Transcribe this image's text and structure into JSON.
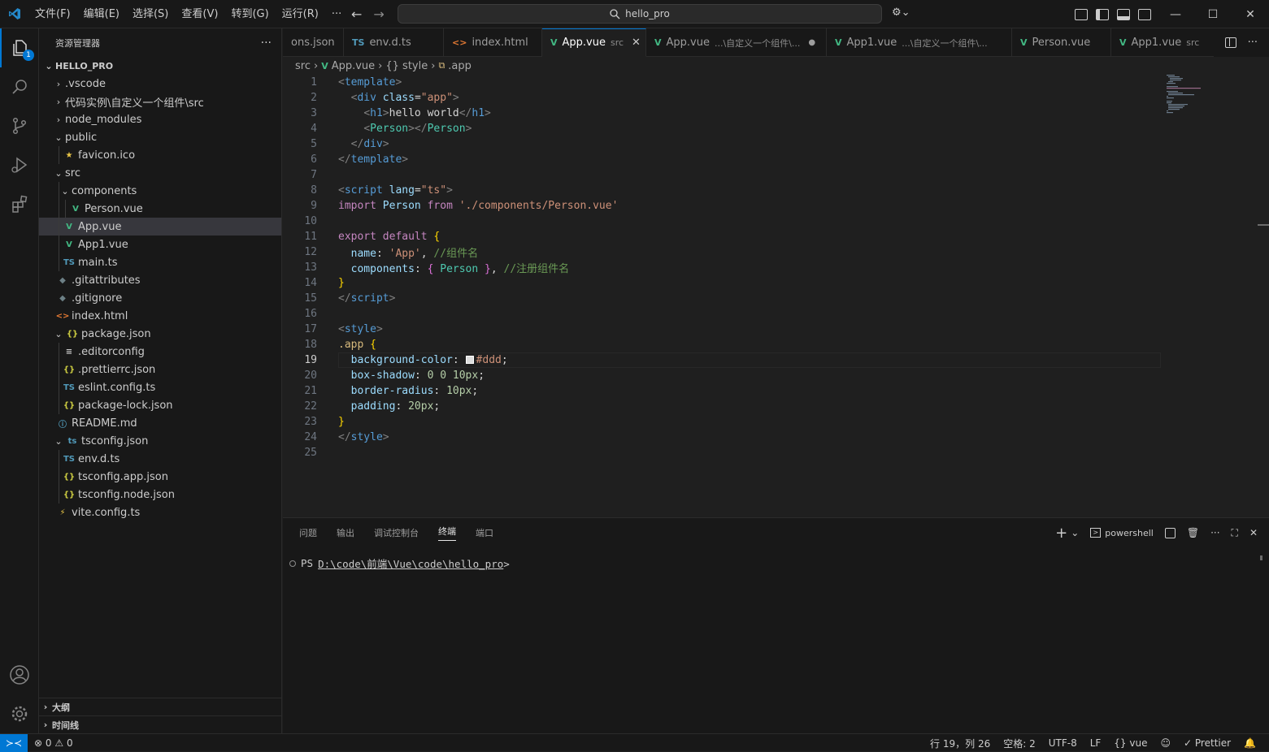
{
  "menu": [
    "文件(F)",
    "编辑(E)",
    "选择(S)",
    "查看(V)",
    "转到(G)",
    "运行(R)",
    "···"
  ],
  "search": {
    "text": "hello_pro"
  },
  "sidebar": {
    "title": "资源管理器",
    "root": "HELLO_PRO",
    "items": [
      {
        "label": ".vscode",
        "depth": 0,
        "kind": "folder",
        "open": false,
        "icon": "",
        "color": "#cccccc"
      },
      {
        "label": "代码实例\\自定义一个组件\\src",
        "depth": 0,
        "kind": "folder",
        "open": false,
        "icon": "",
        "color": "#cccccc"
      },
      {
        "label": "node_modules",
        "depth": 0,
        "kind": "folder",
        "open": false,
        "icon": "",
        "color": "#cccccc"
      },
      {
        "label": "public",
        "depth": 0,
        "kind": "folder",
        "open": true,
        "icon": "",
        "color": "#cccccc"
      },
      {
        "label": "favicon.ico",
        "depth": 1,
        "kind": "file",
        "icon": "★",
        "color": "#e8c547"
      },
      {
        "label": "src",
        "depth": 0,
        "kind": "folder",
        "open": true,
        "icon": "",
        "color": "#cccccc"
      },
      {
        "label": "components",
        "depth": 1,
        "kind": "folder",
        "open": true,
        "icon": "",
        "color": "#cccccc"
      },
      {
        "label": "Person.vue",
        "depth": 2,
        "kind": "file",
        "icon": "V",
        "color": "#42b883"
      },
      {
        "label": "App.vue",
        "depth": 1,
        "kind": "file",
        "icon": "V",
        "color": "#42b883",
        "selected": true
      },
      {
        "label": "App1.vue",
        "depth": 1,
        "kind": "file",
        "icon": "V",
        "color": "#42b883"
      },
      {
        "label": "main.ts",
        "depth": 1,
        "kind": "file",
        "icon": "TS",
        "color": "#519aba"
      },
      {
        "label": ".gitattributes",
        "depth": 0,
        "kind": "file",
        "icon": "◆",
        "color": "#6d8086"
      },
      {
        "label": ".gitignore",
        "depth": 0,
        "kind": "file",
        "icon": "◆",
        "color": "#6d8086"
      },
      {
        "label": "index.html",
        "depth": 0,
        "kind": "file",
        "icon": "<>",
        "color": "#e37933"
      },
      {
        "label": "package.json",
        "depth": 0,
        "kind": "folder-file",
        "open": true,
        "icon": "{}",
        "color": "#cbcb41"
      },
      {
        "label": ".editorconfig",
        "depth": 1,
        "kind": "file",
        "icon": "≡",
        "color": "#cccccc"
      },
      {
        "label": ".prettierrc.json",
        "depth": 1,
        "kind": "file",
        "icon": "{}",
        "color": "#cbcb41"
      },
      {
        "label": "eslint.config.ts",
        "depth": 1,
        "kind": "file",
        "icon": "TS",
        "color": "#519aba"
      },
      {
        "label": "package-lock.json",
        "depth": 1,
        "kind": "file",
        "icon": "{}",
        "color": "#cbcb41"
      },
      {
        "label": "README.md",
        "depth": 0,
        "kind": "file",
        "icon": "ⓘ",
        "color": "#519aba"
      },
      {
        "label": "tsconfig.json",
        "depth": 0,
        "kind": "folder-file",
        "open": true,
        "icon": "ts",
        "color": "#519aba"
      },
      {
        "label": "env.d.ts",
        "depth": 1,
        "kind": "file",
        "icon": "TS",
        "color": "#519aba"
      },
      {
        "label": "tsconfig.app.json",
        "depth": 1,
        "kind": "file",
        "icon": "{}",
        "color": "#cbcb41"
      },
      {
        "label": "tsconfig.node.json",
        "depth": 1,
        "kind": "file",
        "icon": "{}",
        "color": "#cbcb41"
      },
      {
        "label": "vite.config.ts",
        "depth": 0,
        "kind": "file",
        "icon": "⚡",
        "color": "#e8c547"
      }
    ],
    "outline": "大纲",
    "timeline": "时间线"
  },
  "tabs": [
    {
      "label": "ons.json",
      "desc": "",
      "icon": "",
      "color": "#cccccc"
    },
    {
      "label": "env.d.ts",
      "desc": "",
      "icon": "TS",
      "color": "#519aba"
    },
    {
      "label": "index.html",
      "desc": "",
      "icon": "<>",
      "color": "#e37933"
    },
    {
      "label": "App.vue",
      "desc": "src",
      "icon": "V",
      "color": "#42b883",
      "active": true
    },
    {
      "label": "App.vue",
      "desc": "...\\自定义一个组件\\...",
      "icon": "V",
      "color": "#42b883",
      "dirty": true
    },
    {
      "label": "App1.vue",
      "desc": "...\\自定义一个组件\\...",
      "icon": "V",
      "color": "#42b883"
    },
    {
      "label": "Person.vue",
      "desc": "",
      "icon": "V",
      "color": "#42b883"
    },
    {
      "label": "App1.vue",
      "desc": "src",
      "icon": "V",
      "color": "#42b883"
    }
  ],
  "breadcrumb": [
    "src",
    "App.vue",
    "{} style",
    ".app"
  ],
  "current_line": 19,
  "code": [
    [
      [
        "tag",
        "<"
      ],
      [
        "tn",
        "template"
      ],
      [
        "tag",
        ">"
      ]
    ],
    [
      [
        "tx",
        "  "
      ],
      [
        "tag",
        "<"
      ],
      [
        "tn",
        "div"
      ],
      [
        "tx",
        " "
      ],
      [
        "at",
        "class"
      ],
      [
        "tx",
        "="
      ],
      [
        "st",
        "\"app\""
      ],
      [
        "tag",
        ">"
      ]
    ],
    [
      [
        "tx",
        "    "
      ],
      [
        "tag",
        "<"
      ],
      [
        "tn",
        "h1"
      ],
      [
        "tag",
        ">"
      ],
      [
        "tx",
        "hello world"
      ],
      [
        "tag",
        "</"
      ],
      [
        "tn",
        "h1"
      ],
      [
        "tag",
        ">"
      ]
    ],
    [
      [
        "tx",
        "    "
      ],
      [
        "tag",
        "<"
      ],
      [
        "cls",
        "Person"
      ],
      [
        "tag",
        "></"
      ],
      [
        "cls",
        "Person"
      ],
      [
        "tag",
        ">"
      ]
    ],
    [
      [
        "tx",
        "  "
      ],
      [
        "tag",
        "</"
      ],
      [
        "tn",
        "div"
      ],
      [
        "tag",
        ">"
      ]
    ],
    [
      [
        "tag",
        "</"
      ],
      [
        "tn",
        "template"
      ],
      [
        "tag",
        ">"
      ]
    ],
    [],
    [
      [
        "tag",
        "<"
      ],
      [
        "tn",
        "script"
      ],
      [
        "tx",
        " "
      ],
      [
        "at",
        "lang"
      ],
      [
        "tx",
        "="
      ],
      [
        "st",
        "\"ts\""
      ],
      [
        "tag",
        ">"
      ]
    ],
    [
      [
        "kw",
        "import"
      ],
      [
        "tx",
        " "
      ],
      [
        "pr",
        "Person"
      ],
      [
        "tx",
        " "
      ],
      [
        "kw",
        "from"
      ],
      [
        "tx",
        " "
      ],
      [
        "st",
        "'./components/Person.vue'"
      ]
    ],
    [],
    [
      [
        "kw",
        "export"
      ],
      [
        "tx",
        " "
      ],
      [
        "kw",
        "default"
      ],
      [
        "tx",
        " "
      ],
      [
        "br",
        "{"
      ]
    ],
    [
      [
        "tx",
        "  "
      ],
      [
        "pr",
        "name"
      ],
      [
        "tx",
        ": "
      ],
      [
        "st",
        "'App'"
      ],
      [
        "tx",
        ", "
      ],
      [
        "cm",
        "//组件名"
      ]
    ],
    [
      [
        "tx",
        "  "
      ],
      [
        "pr",
        "components"
      ],
      [
        "tx",
        ": "
      ],
      [
        "br2",
        "{"
      ],
      [
        "tx",
        " "
      ],
      [
        "cls",
        "Person"
      ],
      [
        "tx",
        " "
      ],
      [
        "br2",
        "}"
      ],
      [
        "tx",
        ", "
      ],
      [
        "cm",
        "//注册组件名"
      ]
    ],
    [
      [
        "br",
        "}"
      ]
    ],
    [
      [
        "tag",
        "</"
      ],
      [
        "tn",
        "script"
      ],
      [
        "tag",
        ">"
      ]
    ],
    [],
    [
      [
        "tag",
        "<"
      ],
      [
        "tn",
        "style"
      ],
      [
        "tag",
        ">"
      ]
    ],
    [
      [
        "sel",
        ".app"
      ],
      [
        "tx",
        " "
      ],
      [
        "br",
        "{"
      ]
    ],
    [
      [
        "tx",
        "  "
      ],
      [
        "pr",
        "background-color"
      ],
      [
        "tx",
        ": "
      ],
      [
        "swatch",
        ""
      ],
      [
        "st",
        "#ddd"
      ],
      [
        "tx",
        ";"
      ]
    ],
    [
      [
        "tx",
        "  "
      ],
      [
        "pr",
        "box-shadow"
      ],
      [
        "tx",
        ": "
      ],
      [
        "nm",
        "0"
      ],
      [
        "tx",
        " "
      ],
      [
        "nm",
        "0"
      ],
      [
        "tx",
        " "
      ],
      [
        "nm",
        "10px"
      ],
      [
        "tx",
        ";"
      ]
    ],
    [
      [
        "tx",
        "  "
      ],
      [
        "pr",
        "border-radius"
      ],
      [
        "tx",
        ": "
      ],
      [
        "nm",
        "10px"
      ],
      [
        "tx",
        ";"
      ]
    ],
    [
      [
        "tx",
        "  "
      ],
      [
        "pr",
        "padding"
      ],
      [
        "tx",
        ": "
      ],
      [
        "nm",
        "20px"
      ],
      [
        "tx",
        ";"
      ]
    ],
    [
      [
        "br",
        "}"
      ]
    ],
    [
      [
        "tag",
        "</"
      ],
      [
        "tn",
        "style"
      ],
      [
        "tag",
        ">"
      ]
    ],
    []
  ],
  "panel": {
    "tabs": [
      "问题",
      "输出",
      "调试控制台",
      "终端",
      "端口"
    ],
    "active_tab": "终端",
    "shell": "powershell",
    "prompt_prefix": "PS",
    "prompt_path": "D:\\code\\前端\\Vue\\code\\hello_pro",
    "prompt_suffix": ">"
  },
  "status": {
    "errors": "0",
    "warnings": "0",
    "position": "行 19，列 26",
    "spaces": "空格: 2",
    "encoding": "UTF-8",
    "eol": "LF",
    "language": "vue",
    "prettier": "Prettier"
  },
  "colors": {
    "accent": "#0078d4",
    "vue": "#42b883",
    "ts": "#519aba"
  }
}
